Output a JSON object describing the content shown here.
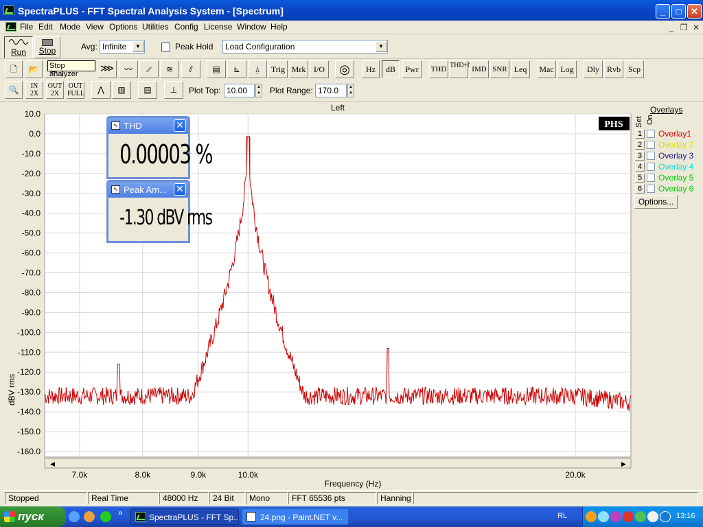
{
  "window": {
    "title": "SpectraPLUS - FFT Spectral Analysis System - [Spectrum]"
  },
  "menu": [
    "File",
    "Edit",
    "Mode",
    "View",
    "Options",
    "Utilities",
    "Config",
    "License",
    "Window",
    "Help"
  ],
  "toolbar1": {
    "run_label": "Run",
    "stop_label": "Stop",
    "avg_label": "Avg:",
    "avg_value": "Infinite",
    "peak_hold_label": "Peak Hold",
    "config_value": "Load Configuration"
  },
  "tooltip": "Stop analyzer",
  "toolbar2": [
    "Trig",
    "Mrk",
    "I/O",
    "Hz",
    "dB",
    "Pwr",
    "THD",
    "THD+N",
    "IMD",
    "SNR",
    "Leq",
    "Mac",
    "Log",
    "Dly",
    "Rvb",
    "Scp"
  ],
  "toolbar3": {
    "plot_top_label": "Plot Top:",
    "plot_top_value": "10.00",
    "plot_range_label": "Plot Range:",
    "plot_range_value": "170.0"
  },
  "plot": {
    "channel_title": "Left",
    "logo": "PHS",
    "xlabel": "Frequency (Hz)",
    "ylabel": "dBV rms"
  },
  "chart_data": {
    "type": "line",
    "title": "Left",
    "xlabel": "Frequency (Hz)",
    "ylabel": "dBV rms",
    "x_scale": "log",
    "xlim": [
      6500,
      22500
    ],
    "ylim": [
      -160,
      10
    ],
    "x_ticks": [
      "7.0k",
      "8.0k",
      "9.0k",
      "10.0k",
      "20.0k"
    ],
    "x_tick_values": [
      7000,
      8000,
      9000,
      10000,
      20000
    ],
    "y_ticks": [
      "10.0",
      "0.0",
      "-10.0",
      "-20.0",
      "-30.0",
      "-40.0",
      "-50.0",
      "-60.0",
      "-70.0",
      "-80.0",
      "-90.0",
      "-100.0",
      "-110.0",
      "-120.0",
      "-130.0",
      "-140.0",
      "-150.0",
      "-160.0"
    ],
    "grid": true,
    "series": [
      {
        "color": "#cc0000",
        "noise_floor_db": -132,
        "points": [
          {
            "x": 6500,
            "y": -134
          },
          {
            "x": 7600,
            "y": -116
          },
          {
            "x": 9400,
            "y": -124
          },
          {
            "x": 9800,
            "y": -110
          },
          {
            "x": 9950,
            "y": -80
          },
          {
            "x": 10000,
            "y": -1.3
          },
          {
            "x": 10050,
            "y": -80
          },
          {
            "x": 10200,
            "y": -112
          },
          {
            "x": 10600,
            "y": -126
          },
          {
            "x": 13450,
            "y": -108
          },
          {
            "x": 22200,
            "y": -136
          }
        ]
      }
    ]
  },
  "thd_window": {
    "title": "THD",
    "value": "0.00003 %"
  },
  "peak_window": {
    "title": "Peak Am...",
    "value": "-1.30 dBV rms"
  },
  "overlays": {
    "header": "Overlays",
    "set_label": "Set",
    "on_label": "On",
    "items": [
      {
        "num": "1",
        "label": "Overlay1",
        "color": "#e00000"
      },
      {
        "num": "2",
        "label": "Overlay 2",
        "color": "#e0e000"
      },
      {
        "num": "3",
        "label": "Overlay 3",
        "color": "#1a1a8a"
      },
      {
        "num": "4",
        "label": "Overlay 4",
        "color": "#00e0e0"
      },
      {
        "num": "5",
        "label": "Overlay 5",
        "color": "#00cc00"
      },
      {
        "num": "6",
        "label": "Overlay 6",
        "color": "#00cc00"
      }
    ],
    "options_label": "Options..."
  },
  "status": [
    "Stopped",
    "Real Time",
    "48000 Hz",
    "24 Bit",
    "Mono",
    "FFT 65536 pts",
    "Hanning"
  ],
  "taskbar": {
    "start_label": "пуск",
    "tasks": [
      "SpectraPLUS - FFT Sp...",
      "24.png - Paint.NET v..."
    ],
    "lang": "RL",
    "time": "13:16"
  }
}
